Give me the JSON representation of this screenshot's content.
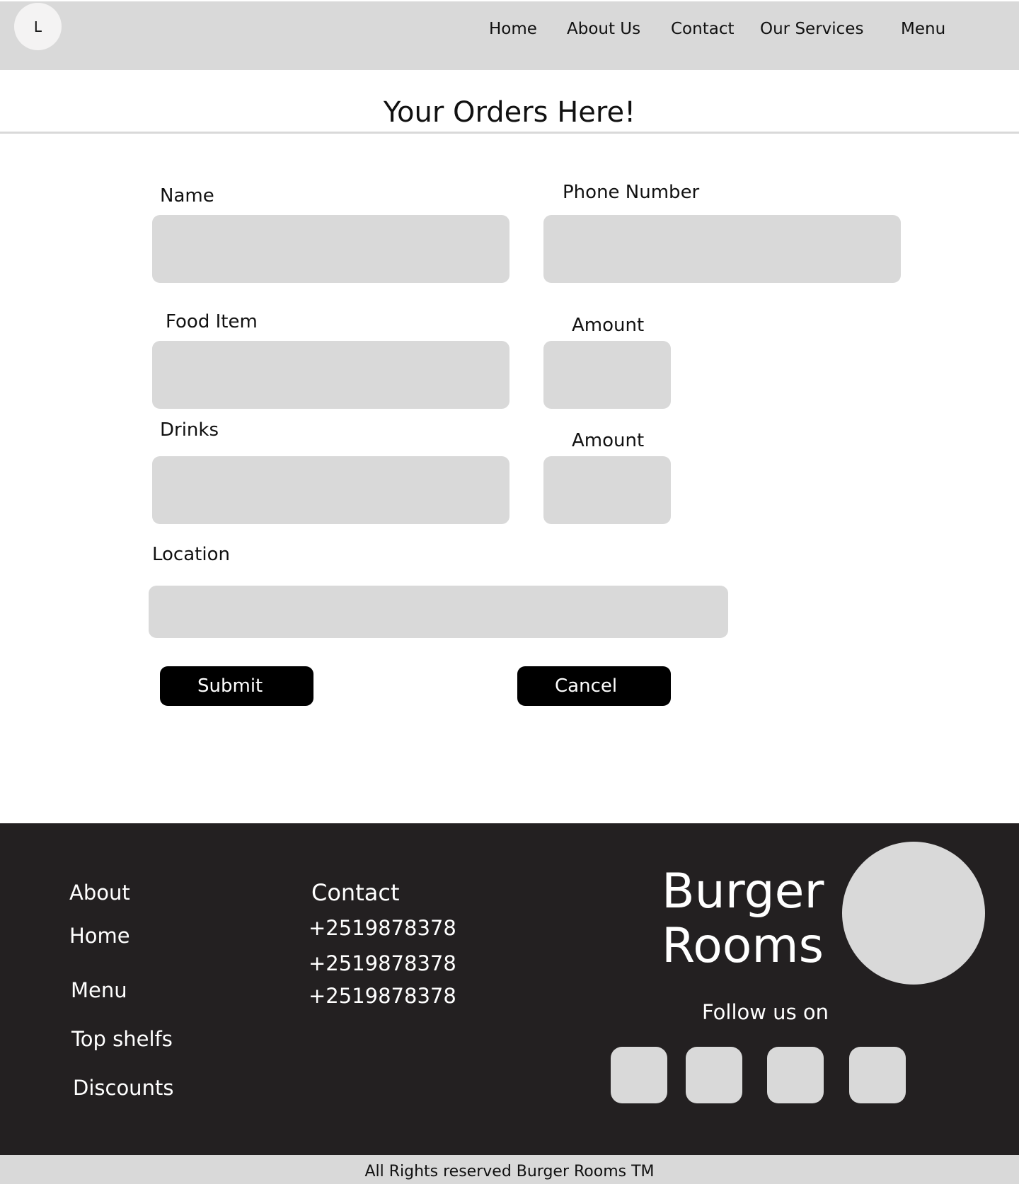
{
  "header": {
    "logo_letter": "L",
    "nav": [
      "Home",
      "About Us",
      "Contact",
      "Our Services",
      "Menu"
    ]
  },
  "page": {
    "title": "Your Orders Here!"
  },
  "form": {
    "name_label": "Name",
    "phone_label": "Phone Number",
    "food_label": "Food Item",
    "food_amount_label": "Amount",
    "drinks_label": "Drinks",
    "drinks_amount_label": "Amount",
    "location_label": "Location",
    "submit_label": "Submit",
    "cancel_label": "Cancel"
  },
  "footer": {
    "links": [
      "About",
      "Home",
      "Menu",
      "Top shelfs",
      "Discounts"
    ],
    "contact_heading": "Contact",
    "phones": [
      "+2519878378",
      "+2519878378",
      "+2519878378"
    ],
    "brand": "Burger Rooms",
    "follow": "Follow us on"
  },
  "copyright": "All Rights reserved Burger Rooms TM",
  "colors": {
    "header_bg": "#d9d9d9",
    "footer_bg": "#232021",
    "button_bg": "#000000",
    "field_bg": "#d9d9d9"
  }
}
